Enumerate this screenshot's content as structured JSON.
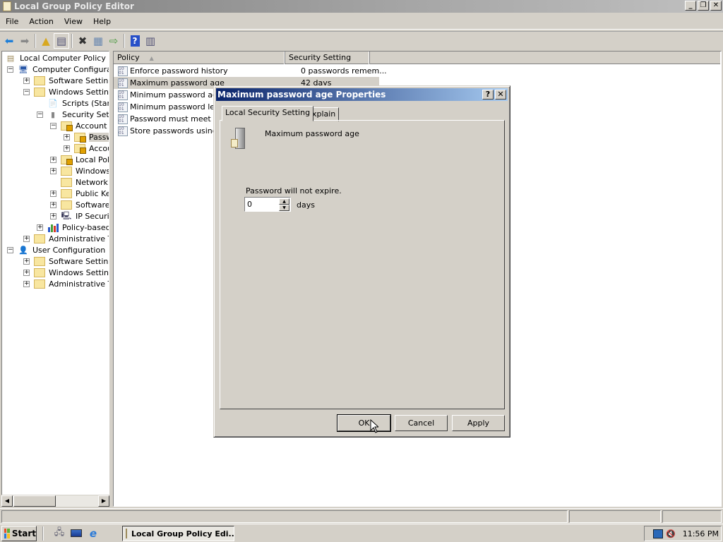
{
  "window": {
    "title": "Local Group Policy Editor",
    "controls": {
      "minimize": "_",
      "restore": "❐",
      "close": "✕"
    }
  },
  "menu": [
    "File",
    "Action",
    "View",
    "Help"
  ],
  "toolbar": {
    "icons": [
      "back-icon",
      "forward-icon",
      "up-folder-icon",
      "show-hide-tree-icon",
      "delete-icon",
      "properties-icon",
      "export-list-icon",
      "help-icon",
      "action-pane-icon"
    ]
  },
  "tree": [
    {
      "label": "Local Computer Policy",
      "level": 0,
      "expander": "",
      "icon": "policy-icon"
    },
    {
      "label": "Computer Configuratio",
      "level": 0,
      "expander": "−",
      "icon": "computer-icon"
    },
    {
      "label": "Software Settings",
      "level": 1,
      "expander": "+",
      "icon": "folder-icon"
    },
    {
      "label": "Windows Settings",
      "level": 1,
      "expander": "−",
      "icon": "folder-icon"
    },
    {
      "label": "Scripts (Startup",
      "level": 2,
      "expander": "",
      "icon": "script-icon"
    },
    {
      "label": "Security Settin",
      "level": 2,
      "expander": "−",
      "icon": "security-icon"
    },
    {
      "label": "Account Po",
      "level": 3,
      "expander": "−",
      "icon": "locked-folder-icon"
    },
    {
      "label": "Passwo",
      "level": 4,
      "expander": "+",
      "icon": "locked-folder-icon",
      "selected": true
    },
    {
      "label": "Accour",
      "level": 4,
      "expander": "+",
      "icon": "locked-folder-icon"
    },
    {
      "label": "Local Policie",
      "level": 3,
      "expander": "+",
      "icon": "locked-folder-icon"
    },
    {
      "label": "Windows F",
      "level": 3,
      "expander": "+",
      "icon": "folder-icon"
    },
    {
      "label": "Network Lis",
      "level": 3,
      "expander": "",
      "icon": "folder-icon"
    },
    {
      "label": "Public Key I",
      "level": 3,
      "expander": "+",
      "icon": "folder-icon"
    },
    {
      "label": "Software R",
      "level": 3,
      "expander": "+",
      "icon": "folder-icon"
    },
    {
      "label": "IP Security",
      "level": 3,
      "expander": "+",
      "icon": "ipsec-icon"
    },
    {
      "label": "Policy-based Q",
      "level": 2,
      "expander": "+",
      "icon": "qos-chart-icon"
    },
    {
      "label": "Administrative Tem",
      "level": 1,
      "expander": "+",
      "icon": "folder-icon"
    },
    {
      "label": "User Configuration",
      "level": 0,
      "expander": "−",
      "icon": "user-icon"
    },
    {
      "label": "Software Settings",
      "level": 1,
      "expander": "+",
      "icon": "folder-icon"
    },
    {
      "label": "Windows Settings",
      "level": 1,
      "expander": "+",
      "icon": "folder-icon"
    },
    {
      "label": "Administrative Tem",
      "level": 1,
      "expander": "+",
      "icon": "folder-icon"
    }
  ],
  "list": {
    "columns": [
      "Policy",
      "Security Setting"
    ],
    "sort_indicator": "▲",
    "rows": [
      {
        "policy": "Enforce password history",
        "setting": "0 passwords remem..."
      },
      {
        "policy": "Maximum password age",
        "setting": "42 days",
        "selected": true
      },
      {
        "policy": "Minimum password age",
        "setting": ""
      },
      {
        "policy": "Minimum password length",
        "setting": ""
      },
      {
        "policy": "Password must meet com",
        "setting": ""
      },
      {
        "policy": "Store passwords using re",
        "setting": ""
      }
    ]
  },
  "dialog": {
    "title": "Maximum password age Properties",
    "help": "?",
    "close": "✕",
    "tabs": [
      "Local Security Setting",
      "Explain"
    ],
    "heading": "Maximum password age",
    "field_label": "Password will not expire.",
    "value": "0",
    "unit": "days",
    "buttons": {
      "ok": "OK",
      "cancel": "Cancel",
      "apply": "Apply"
    }
  },
  "taskbar": {
    "start": "Start",
    "quick_launch": [
      "server-manager-icon",
      "show-desktop-icon",
      "internet-explorer-icon"
    ],
    "task": "Local Group Policy Edi...",
    "clock": "11:56 PM",
    "tray_icons": [
      "network-icon",
      "volume-muted-icon"
    ]
  }
}
